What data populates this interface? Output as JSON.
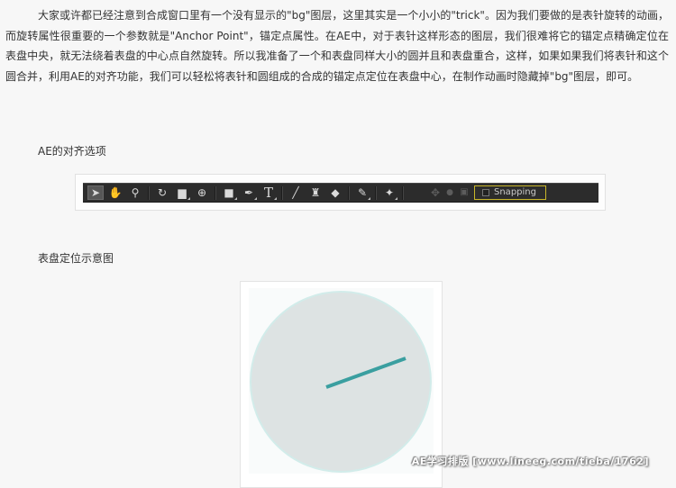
{
  "article": {
    "paragraph": "大家或许都已经注意到合成窗口里有一个没有显示的\"bg\"图层，这里其实是一个小小的\"trick\"。因为我们要做的是表针旋转的动画，而旋转属性很重要的一个参数就是\"Anchor Point\"，锚定点属性。在AE中，对于表针这样形态的图层，我们很难将它的锚定点精确定位在表盘中央，就无法绕着表盘的中心点自然旋转。所以我准备了一个和表盘同样大小的圆并且和表盘重合，这样，如果如果我们将表针和这个圆合并，利用AE的对齐功能，我们可以轻松将表针和圆组成的合成的锚定点定位在表盘中心，在制作动画时隐藏掉\"bg\"图层，即可。",
    "caption_align": "AE的对齐选项",
    "caption_dial": "表盘定位示意图"
  },
  "toolbar": {
    "snapping_label": "Snapping",
    "tools": [
      {
        "name": "selection-tool-icon",
        "glyph": "➤",
        "selected": true
      },
      {
        "name": "hand-tool-icon",
        "glyph": "✋"
      },
      {
        "name": "zoom-tool-icon",
        "glyph": "⚲"
      },
      {
        "name": "rotate-tool-icon",
        "glyph": "↻"
      },
      {
        "name": "camera-tool-icon",
        "glyph": "▆"
      },
      {
        "name": "pan-behind-tool-icon",
        "glyph": "⊕"
      },
      {
        "name": "rectangle-tool-icon",
        "glyph": "■"
      },
      {
        "name": "pen-tool-icon",
        "glyph": "✒"
      },
      {
        "name": "type-tool-icon",
        "glyph": "T"
      },
      {
        "name": "brush-tool-icon",
        "glyph": "╱"
      },
      {
        "name": "clone-stamp-tool-icon",
        "glyph": "♜"
      },
      {
        "name": "eraser-tool-icon",
        "glyph": "◆"
      },
      {
        "name": "roto-brush-tool-icon",
        "glyph": "✎"
      },
      {
        "name": "puppet-pin-tool-icon",
        "glyph": "✦"
      },
      {
        "name": "local-axis-icon",
        "glyph": "✥",
        "dim": true
      },
      {
        "name": "world-axis-icon",
        "glyph": "●",
        "dim": true
      },
      {
        "name": "view-axis-icon",
        "glyph": "▣",
        "dim": true
      }
    ]
  },
  "colors": {
    "dial_fill": "#dde3e3",
    "dial_stroke": "#d2ecea",
    "hand": "#3a9fa0",
    "snap_border": "#c8b62a"
  },
  "watermark": "AE学习排版 [www.lineeg.com/tieba/1762]"
}
